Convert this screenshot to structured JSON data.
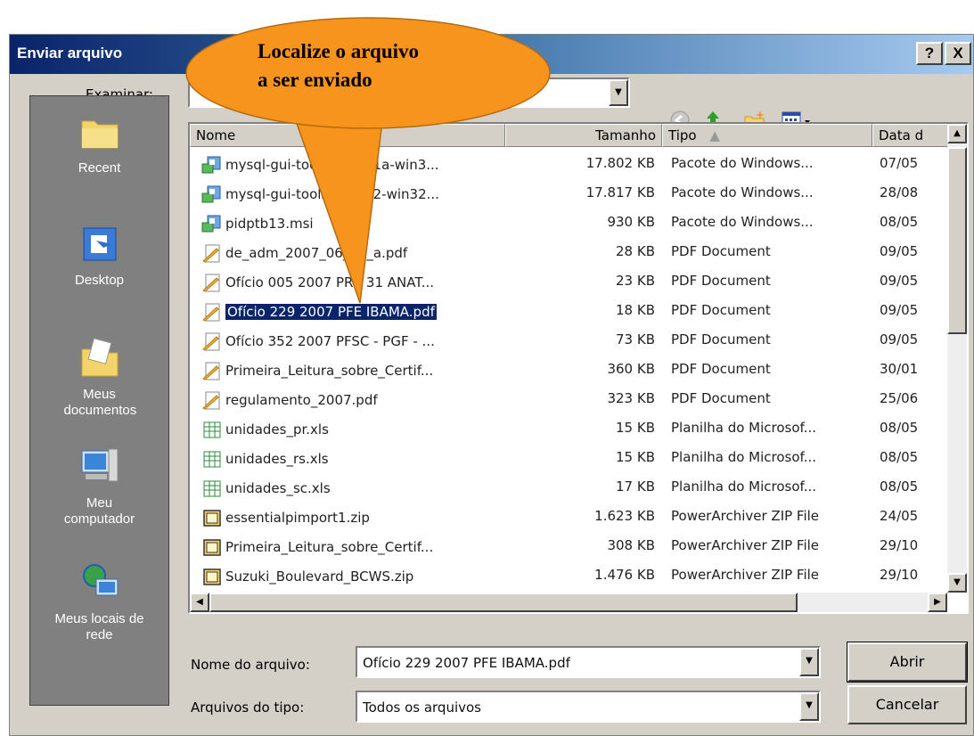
{
  "window": {
    "title": "Enviar arquivo",
    "help_label": "?",
    "close_label": "X"
  },
  "callout": {
    "line1": "Localize o arquivo",
    "line2": "a ser enviado",
    "color": "#f7941d"
  },
  "look_in": {
    "label": "Examinar:",
    "value": ""
  },
  "toolbar": {
    "icons": [
      "back-icon",
      "up-folder-icon",
      "new-folder-icon",
      "view-menu-icon"
    ]
  },
  "places": [
    {
      "label": "Recent",
      "icon": "recent-folder-icon"
    },
    {
      "label": "Desktop",
      "icon": "desktop-icon"
    },
    {
      "label": "Meus documentos",
      "icon": "my-documents-icon"
    },
    {
      "label": "Meu computador",
      "icon": "my-computer-icon"
    },
    {
      "label": "Meus locais de rede",
      "icon": "network-places-icon"
    }
  ],
  "columns": {
    "name": "Nome",
    "size": "Tamanho",
    "type": "Tipo",
    "date": "Data d"
  },
  "files": [
    {
      "name": "mysql-gui-tools-5.0-r11a-win3...",
      "size": "17.802 KB",
      "type": "Pacote do Windows...",
      "date": "07/05",
      "icon": "msi"
    },
    {
      "name": "mysql-gui-tools-5.0-r12-win32...",
      "size": "17.817 KB",
      "type": "Pacote do Windows...",
      "date": "28/08",
      "icon": "msi"
    },
    {
      "name": "pidptb13.msi",
      "size": "930 KB",
      "type": "Pacote do Windows...",
      "date": "08/05",
      "icon": "msi"
    },
    {
      "name": "de_adm_2007_06_04_a.pdf",
      "size": "28 KB",
      "type": "PDF Document",
      "date": "09/05",
      "icon": "pdf"
    },
    {
      "name": "Ofício 005 2007 PRC 31 ANAT...",
      "size": "23 KB",
      "type": "PDF Document",
      "date": "09/05",
      "icon": "pdf"
    },
    {
      "name": "Ofício 229 2007 PFE IBAMA.pdf",
      "size": "18 KB",
      "type": "PDF Document",
      "date": "09/05",
      "icon": "pdf",
      "selected": true
    },
    {
      "name": "Ofício 352 2007 PFSC - PGF - ...",
      "size": "73 KB",
      "type": "PDF Document",
      "date": "09/05",
      "icon": "pdf"
    },
    {
      "name": "Primeira_Leitura_sobre_Certif...",
      "size": "360 KB",
      "type": "PDF Document",
      "date": "30/01",
      "icon": "pdf"
    },
    {
      "name": "regulamento_2007.pdf",
      "size": "323 KB",
      "type": "PDF Document",
      "date": "25/06",
      "icon": "pdf"
    },
    {
      "name": "unidades_pr.xls",
      "size": "15 KB",
      "type": "Planilha do Microsof...",
      "date": "08/05",
      "icon": "xls"
    },
    {
      "name": "unidades_rs.xls",
      "size": "15 KB",
      "type": "Planilha do Microsof...",
      "date": "08/05",
      "icon": "xls"
    },
    {
      "name": "unidades_sc.xls",
      "size": "17 KB",
      "type": "Planilha do Microsof...",
      "date": "08/05",
      "icon": "xls"
    },
    {
      "name": "essentialpimport1.zip",
      "size": "1.623 KB",
      "type": "PowerArchiver ZIP File",
      "date": "24/05",
      "icon": "zip"
    },
    {
      "name": "Primeira_Leitura_sobre_Certif...",
      "size": "308 KB",
      "type": "PowerArchiver ZIP File",
      "date": "29/10",
      "icon": "zip"
    },
    {
      "name": "Suzuki_Boulevard_BCWS.zip",
      "size": "1.476 KB",
      "type": "PowerArchiver ZIP File",
      "date": "29/10",
      "icon": "zip"
    }
  ],
  "filename": {
    "label": "Nome do arquivo:",
    "value": "Ofício 229 2007 PFE IBAMA.pdf"
  },
  "filetype": {
    "label": "Arquivos do tipo:",
    "value": "Todos os arquivos"
  },
  "buttons": {
    "open": "Abrir",
    "cancel": "Cancelar"
  }
}
